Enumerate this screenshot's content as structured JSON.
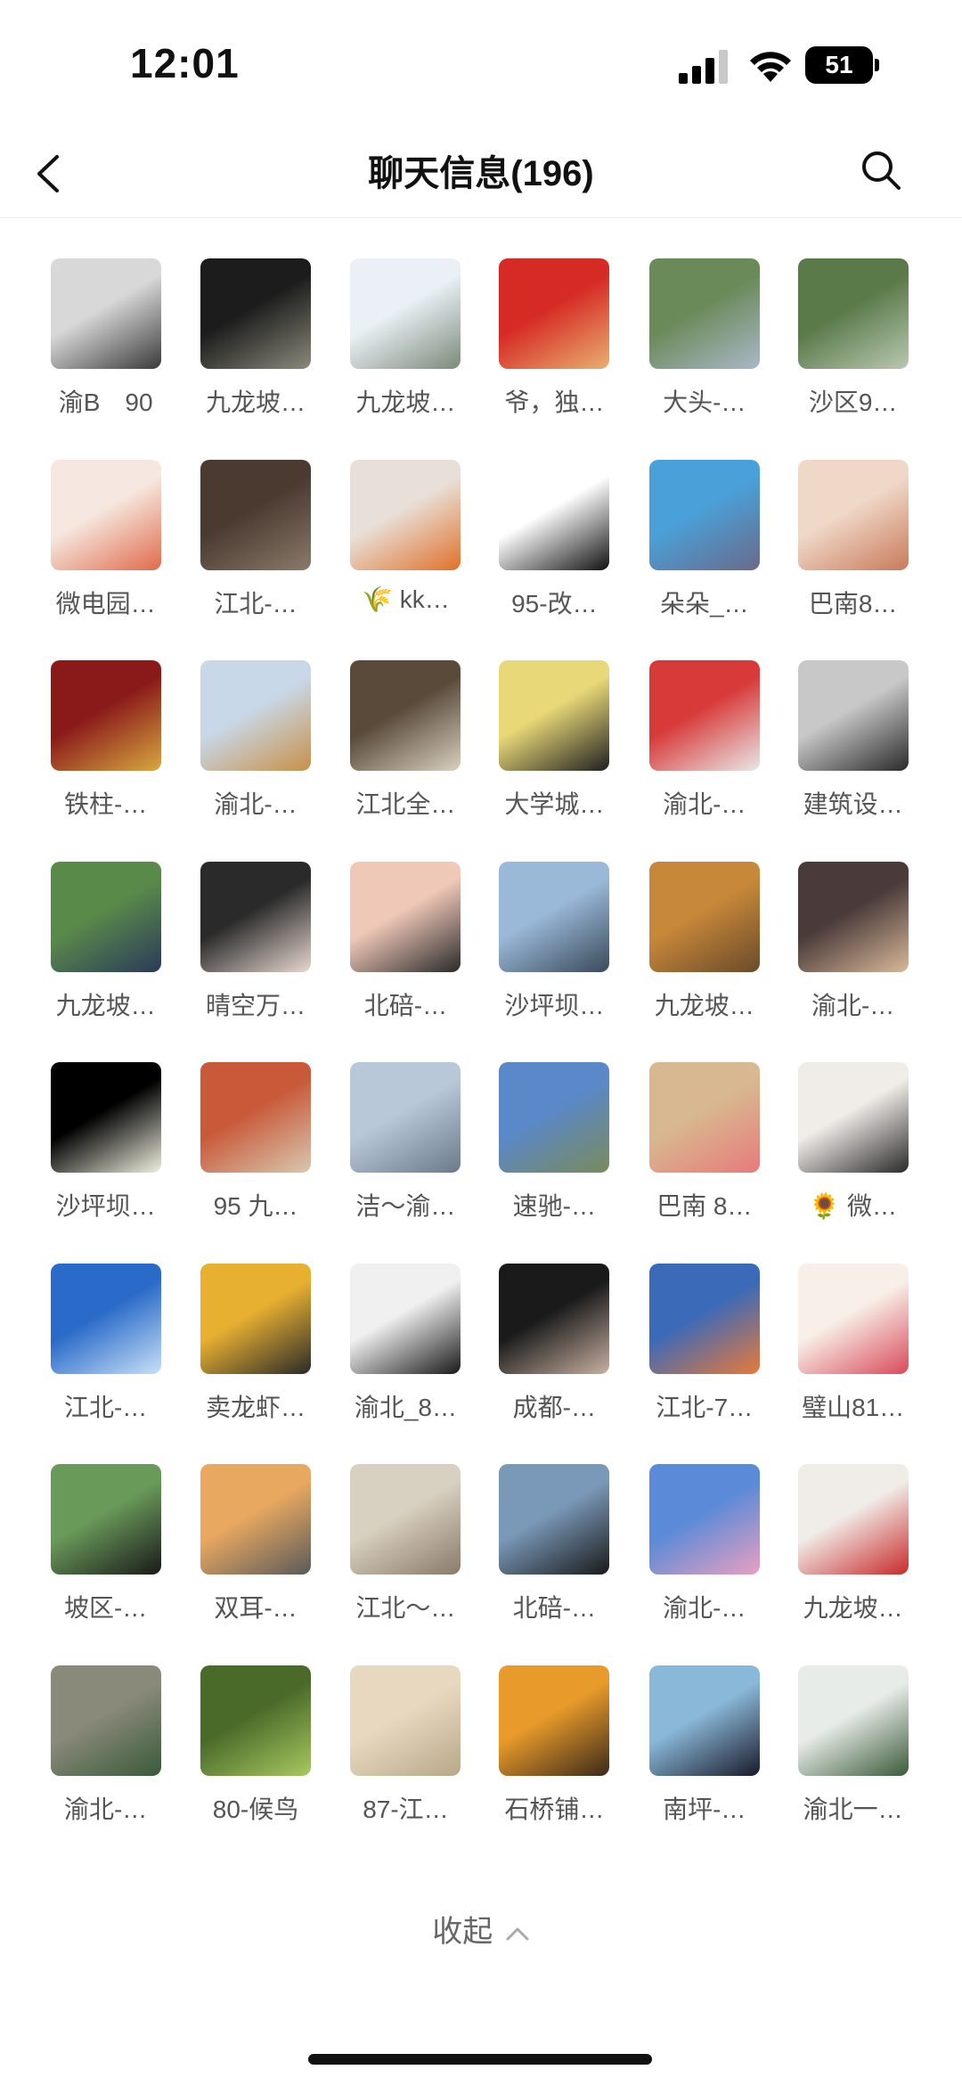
{
  "status_bar": {
    "time": "12:01",
    "battery": "51"
  },
  "nav": {
    "title": "聊天信息(196)"
  },
  "members": [
    {
      "name": "渝B　90",
      "colors": [
        "#d8d8d8",
        "#3a3a3a"
      ]
    },
    {
      "name": "九龙坡…",
      "colors": [
        "#1c1c1c",
        "#8a8a7a"
      ]
    },
    {
      "name": "九龙坡…",
      "colors": [
        "#eaf0f5",
        "#7a8a7a"
      ]
    },
    {
      "name": "爷，独…",
      "colors": [
        "#d62a24",
        "#e8b070"
      ]
    },
    {
      "name": "大头-…",
      "colors": [
        "#6a8a5a",
        "#aab8c8"
      ]
    },
    {
      "name": "沙区9…",
      "colors": [
        "#5a7a4a",
        "#b8c8b0"
      ]
    },
    {
      "name": "微电园…",
      "colors": [
        "#f6e8e0",
        "#e06a4a"
      ]
    },
    {
      "name": "江北-…",
      "colors": [
        "#4a3a30",
        "#8a7a6a"
      ]
    },
    {
      "name": "🌾 kk…",
      "colors": [
        "#e8e0d8",
        "#e0702a"
      ]
    },
    {
      "name": "95-改…",
      "colors": [
        "#ffffff",
        "#111111"
      ]
    },
    {
      "name": "朵朵_…",
      "colors": [
        "#4aa0d8",
        "#6a6a8a"
      ]
    },
    {
      "name": "巴南8…",
      "colors": [
        "#f0d8c8",
        "#c87a5a"
      ]
    },
    {
      "name": "铁柱-…",
      "colors": [
        "#8a1a1a",
        "#d8a840"
      ]
    },
    {
      "name": "渝北-…",
      "colors": [
        "#c8d8e8",
        "#c89048"
      ]
    },
    {
      "name": "江北全…",
      "colors": [
        "#5a4a3a",
        "#d8d0c0"
      ]
    },
    {
      "name": "大学城…",
      "colors": [
        "#e8d878",
        "#202020"
      ]
    },
    {
      "name": "渝北-…",
      "colors": [
        "#d83a3a",
        "#e8e8e8"
      ]
    },
    {
      "name": "建筑设…",
      "colors": [
        "#c8c8c8",
        "#2a2a2a"
      ]
    },
    {
      "name": "九龙坡…",
      "colors": [
        "#5a8a4a",
        "#2a3a5a"
      ]
    },
    {
      "name": "晴空万…",
      "colors": [
        "#2a2a2a",
        "#e8d8d0"
      ]
    },
    {
      "name": "北碚-…",
      "colors": [
        "#f0c8b8",
        "#2a2a2a"
      ]
    },
    {
      "name": "沙坪坝…",
      "colors": [
        "#9ab8d8",
        "#3a4a5a"
      ]
    },
    {
      "name": "九龙坡…",
      "colors": [
        "#c8883a",
        "#6a4a2a"
      ]
    },
    {
      "name": "渝北-…",
      "colors": [
        "#4a3a3a",
        "#d8b898"
      ]
    },
    {
      "name": "沙坪坝…",
      "colors": [
        "#000000",
        "#f0f0e0"
      ]
    },
    {
      "name": "95 九…",
      "colors": [
        "#c85a3a",
        "#d8c8b0"
      ]
    },
    {
      "name": "洁～渝…",
      "colors": [
        "#b8c8d8",
        "#6a7a8a"
      ]
    },
    {
      "name": "速驰-…",
      "colors": [
        "#5a88c8",
        "#7a8a5a"
      ]
    },
    {
      "name": "巴南 8…",
      "colors": [
        "#d8b890",
        "#e87a7a"
      ]
    },
    {
      "name": "🌻 微…",
      "colors": [
        "#f0ece8",
        "#2a2a2a"
      ]
    },
    {
      "name": "江北-…",
      "colors": [
        "#2a6ac8",
        "#c8e0f8"
      ]
    },
    {
      "name": "卖龙虾…",
      "colors": [
        "#e8b030",
        "#2a2a2a"
      ]
    },
    {
      "name": "渝北_8…",
      "colors": [
        "#f0f0f0",
        "#1a1a1a"
      ]
    },
    {
      "name": "成都-…",
      "colors": [
        "#1a1a1a",
        "#c8b0a0"
      ]
    },
    {
      "name": "江北-7…",
      "colors": [
        "#3a6ab8",
        "#e87a3a"
      ]
    },
    {
      "name": "璧山81…",
      "colors": [
        "#f8f0e8",
        "#d84a5a"
      ]
    },
    {
      "name": "坡区-…",
      "colors": [
        "#6a9a5a",
        "#1a1a1a"
      ]
    },
    {
      "name": "双耳-…",
      "colors": [
        "#e8a860",
        "#5a5a5a"
      ]
    },
    {
      "name": "江北～…",
      "colors": [
        "#d8d0c0",
        "#8a7a6a"
      ]
    },
    {
      "name": "北碚-…",
      "colors": [
        "#7a98b8",
        "#1a1a1a"
      ]
    },
    {
      "name": "渝北-…",
      "colors": [
        "#5a8ad8",
        "#e8a0c0"
      ]
    },
    {
      "name": "九龙坡…",
      "colors": [
        "#f0ece8",
        "#c82a2a"
      ]
    },
    {
      "name": "渝北-…",
      "colors": [
        "#8a8a7a",
        "#3a5a3a"
      ]
    },
    {
      "name": "80-候鸟",
      "colors": [
        "#4a6a2a",
        "#a8c860"
      ]
    },
    {
      "name": "87-江…",
      "colors": [
        "#e8d8c0",
        "#b8a888"
      ]
    },
    {
      "name": "石桥铺…",
      "colors": [
        "#e89a2a",
        "#3a2a1a"
      ]
    },
    {
      "name": "南坪-…",
      "colors": [
        "#8ab8d8",
        "#1a1a2a"
      ]
    },
    {
      "name": "渝北一…",
      "colors": [
        "#e8ece8",
        "#3a5a3a"
      ]
    }
  ],
  "collapse": {
    "label": "收起"
  }
}
